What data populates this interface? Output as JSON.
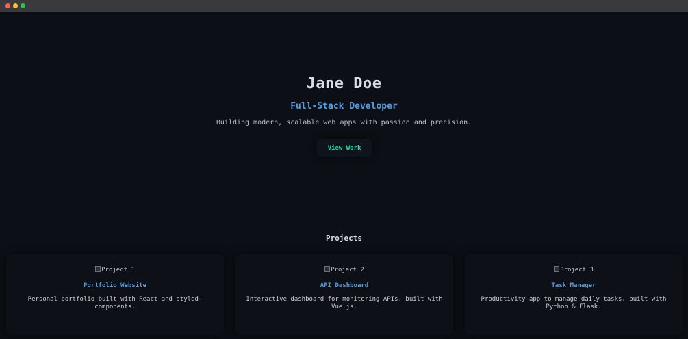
{
  "hero": {
    "name": "Jane Doe",
    "role": "Full-Stack Developer",
    "tagline": "Building modern, scalable web apps with passion and precision.",
    "cta_label": "View Work"
  },
  "projects": {
    "title": "Projects",
    "items": [
      {
        "image_alt": "Project 1",
        "title": "Portfolio Website",
        "description": "Personal portfolio built with React and styled-components."
      },
      {
        "image_alt": "Project 2",
        "title": "API Dashboard",
        "description": "Interactive dashboard for monitoring APIs, built with Vue.js."
      },
      {
        "image_alt": "Project 3",
        "title": "Task Manager",
        "description": "Productivity app to manage daily tasks, built with Python & Flask."
      }
    ]
  },
  "colors": {
    "background": "#0c0f15",
    "accent_blue": "#4d9ee8",
    "accent_green": "#2bd4a0"
  }
}
